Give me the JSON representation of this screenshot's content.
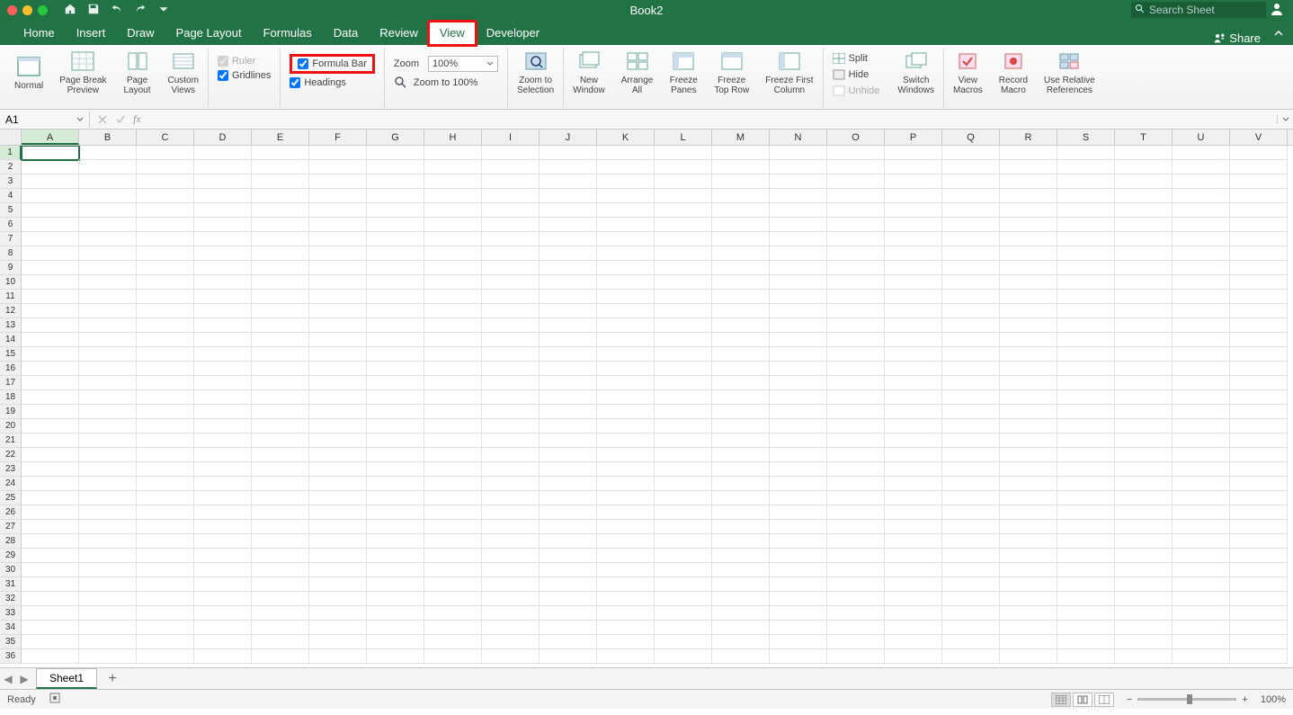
{
  "title": "Book2",
  "search_placeholder": "Search Sheet",
  "tabs": [
    "Home",
    "Insert",
    "Draw",
    "Page Layout",
    "Formulas",
    "Data",
    "Review",
    "View",
    "Developer"
  ],
  "active_tab_index": 7,
  "share_label": "Share",
  "ribbon": {
    "views": {
      "normal": "Normal",
      "pbp": "Page Break\nPreview",
      "layout": "Page\nLayout",
      "custom": "Custom\nViews"
    },
    "show": {
      "ruler": "Ruler",
      "gridlines": "Gridlines",
      "formula_bar": "Formula Bar",
      "headings": "Headings"
    },
    "zoom": {
      "label": "Zoom",
      "value": "100%",
      "to100": "Zoom to 100%",
      "to_sel": "Zoom to\nSelection"
    },
    "window": {
      "new": "New\nWindow",
      "arrange": "Arrange\nAll",
      "freeze": "Freeze\nPanes",
      "freeze_top": "Freeze\nTop Row",
      "freeze_first": "Freeze First\nColumn",
      "split": "Split",
      "hide": "Hide",
      "unhide": "Unhide",
      "switch": "Switch\nWindows"
    },
    "macros": {
      "view": "View\nMacros",
      "record": "Record\nMacro",
      "relative": "Use Relative\nReferences"
    }
  },
  "namebox": "A1",
  "fx": "fx",
  "columns": [
    "A",
    "B",
    "C",
    "D",
    "E",
    "F",
    "G",
    "H",
    "I",
    "J",
    "K",
    "L",
    "M",
    "N",
    "O",
    "P",
    "Q",
    "R",
    "S",
    "T",
    "U",
    "V"
  ],
  "row_count": 36,
  "sheet": "Sheet1",
  "status": "Ready",
  "zoom_pct": "100%"
}
